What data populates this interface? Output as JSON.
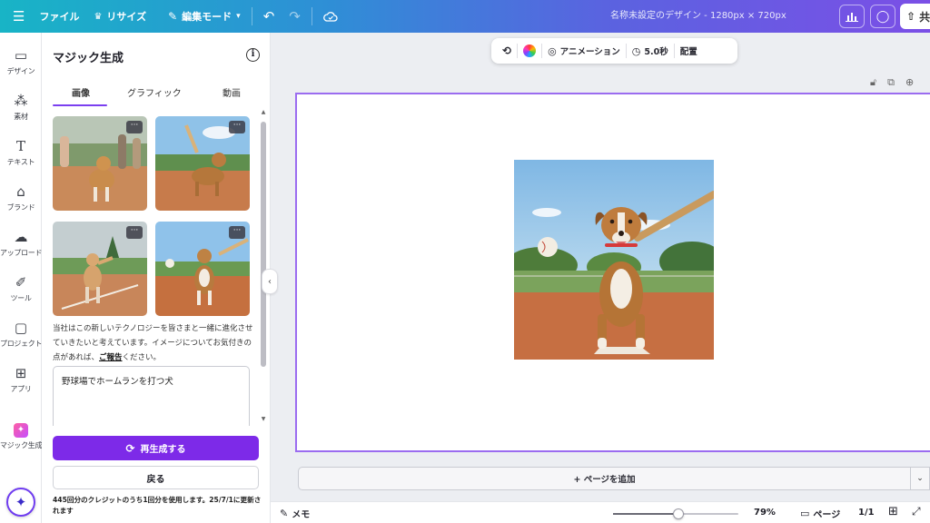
{
  "topbar": {
    "menu_icon": "hamburger-icon",
    "file": "ファイル",
    "resize": "リサイズ",
    "edit_mode": "編集モード",
    "doc_title": "名称未設定のデザイン - 1280px × 720px",
    "share_label": "共"
  },
  "rail": {
    "items": [
      {
        "label": "デザイン",
        "icon": "layout-icon"
      },
      {
        "label": "素材",
        "icon": "elements-icon"
      },
      {
        "label": "テキスト",
        "icon": "text-icon"
      },
      {
        "label": "ブランド",
        "icon": "brand-icon"
      },
      {
        "label": "アップロード",
        "icon": "upload-cloud-icon"
      },
      {
        "label": "ツール",
        "icon": "pen-tool-icon"
      },
      {
        "label": "プロジェクト",
        "icon": "folder-icon"
      },
      {
        "label": "アプリ",
        "icon": "apps-icon"
      },
      {
        "label": "マジック生成",
        "icon": "magic-media-icon"
      }
    ]
  },
  "panel": {
    "title": "マジック生成",
    "tabs": [
      "画像",
      "グラフィック",
      "動画"
    ],
    "active_tab": "画像",
    "notice_text": "当社はこの新しいテクノロジーを皆さまと一緒に進化させていきたいと考えています。イメージについてお気付きの点があれば、",
    "notice_link": "ご報告",
    "notice_tail": "ください。",
    "prompt": "野球場でホームランを打つ犬",
    "regenerate_label": "再生成する",
    "back_label": "戻る",
    "credit_note": "445回分のクレジットのうち1回分を使用します。25/7/1に更新されます"
  },
  "canvas_toolbar": {
    "animation": "アニメーション",
    "duration": "5.0秒",
    "position": "配置"
  },
  "canvas": {
    "add_page": "+ ページを追加"
  },
  "bottombar": {
    "memo": "メモ",
    "zoom": "79%",
    "zoom_level": 0.52,
    "page_label": "ページ",
    "page_count": "1/1"
  },
  "colors": {
    "accent": "#7d2ae8",
    "selection": "#9b6cf0"
  }
}
